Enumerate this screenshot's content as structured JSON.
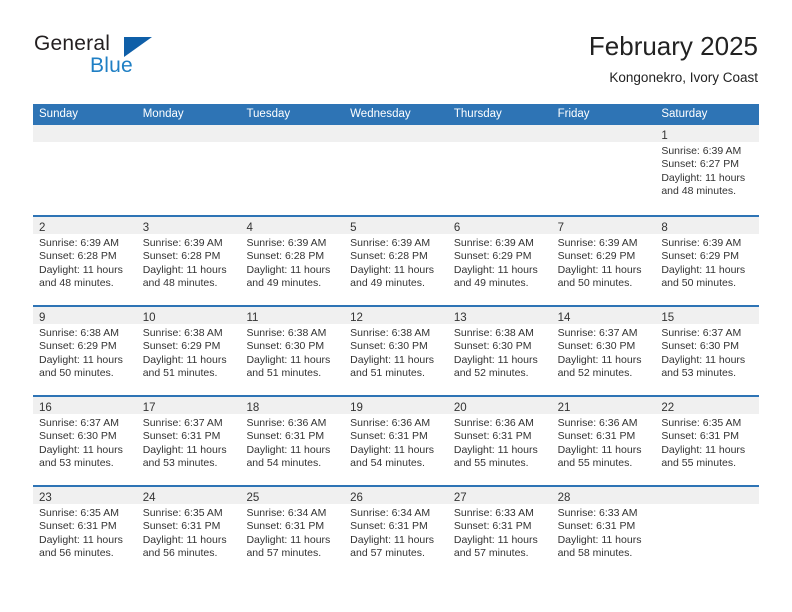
{
  "brand": {
    "name_part1": "General",
    "name_part2": "Blue",
    "accent_color": "#1f7fc4",
    "logo_triangle_color": "#0f5fa8"
  },
  "header": {
    "title": "February 2025",
    "subtitle": "Kongonekro, Ivory Coast"
  },
  "calendar": {
    "header_bg": "#2e74b5",
    "row_divider_color": "#2e74b5",
    "day_strip_bg": "#f0f0f0",
    "weekdays": [
      "Sunday",
      "Monday",
      "Tuesday",
      "Wednesday",
      "Thursday",
      "Friday",
      "Saturday"
    ],
    "weeks": [
      [
        {
          "day": "",
          "lines": []
        },
        {
          "day": "",
          "lines": []
        },
        {
          "day": "",
          "lines": []
        },
        {
          "day": "",
          "lines": []
        },
        {
          "day": "",
          "lines": []
        },
        {
          "day": "",
          "lines": []
        },
        {
          "day": "1",
          "lines": [
            "Sunrise: 6:39 AM",
            "Sunset: 6:27 PM",
            "Daylight: 11 hours",
            "and 48 minutes."
          ]
        }
      ],
      [
        {
          "day": "2",
          "lines": [
            "Sunrise: 6:39 AM",
            "Sunset: 6:28 PM",
            "Daylight: 11 hours",
            "and 48 minutes."
          ]
        },
        {
          "day": "3",
          "lines": [
            "Sunrise: 6:39 AM",
            "Sunset: 6:28 PM",
            "Daylight: 11 hours",
            "and 48 minutes."
          ]
        },
        {
          "day": "4",
          "lines": [
            "Sunrise: 6:39 AM",
            "Sunset: 6:28 PM",
            "Daylight: 11 hours",
            "and 49 minutes."
          ]
        },
        {
          "day": "5",
          "lines": [
            "Sunrise: 6:39 AM",
            "Sunset: 6:28 PM",
            "Daylight: 11 hours",
            "and 49 minutes."
          ]
        },
        {
          "day": "6",
          "lines": [
            "Sunrise: 6:39 AM",
            "Sunset: 6:29 PM",
            "Daylight: 11 hours",
            "and 49 minutes."
          ]
        },
        {
          "day": "7",
          "lines": [
            "Sunrise: 6:39 AM",
            "Sunset: 6:29 PM",
            "Daylight: 11 hours",
            "and 50 minutes."
          ]
        },
        {
          "day": "8",
          "lines": [
            "Sunrise: 6:39 AM",
            "Sunset: 6:29 PM",
            "Daylight: 11 hours",
            "and 50 minutes."
          ]
        }
      ],
      [
        {
          "day": "9",
          "lines": [
            "Sunrise: 6:38 AM",
            "Sunset: 6:29 PM",
            "Daylight: 11 hours",
            "and 50 minutes."
          ]
        },
        {
          "day": "10",
          "lines": [
            "Sunrise: 6:38 AM",
            "Sunset: 6:29 PM",
            "Daylight: 11 hours",
            "and 51 minutes."
          ]
        },
        {
          "day": "11",
          "lines": [
            "Sunrise: 6:38 AM",
            "Sunset: 6:30 PM",
            "Daylight: 11 hours",
            "and 51 minutes."
          ]
        },
        {
          "day": "12",
          "lines": [
            "Sunrise: 6:38 AM",
            "Sunset: 6:30 PM",
            "Daylight: 11 hours",
            "and 51 minutes."
          ]
        },
        {
          "day": "13",
          "lines": [
            "Sunrise: 6:38 AM",
            "Sunset: 6:30 PM",
            "Daylight: 11 hours",
            "and 52 minutes."
          ]
        },
        {
          "day": "14",
          "lines": [
            "Sunrise: 6:37 AM",
            "Sunset: 6:30 PM",
            "Daylight: 11 hours",
            "and 52 minutes."
          ]
        },
        {
          "day": "15",
          "lines": [
            "Sunrise: 6:37 AM",
            "Sunset: 6:30 PM",
            "Daylight: 11 hours",
            "and 53 minutes."
          ]
        }
      ],
      [
        {
          "day": "16",
          "lines": [
            "Sunrise: 6:37 AM",
            "Sunset: 6:30 PM",
            "Daylight: 11 hours",
            "and 53 minutes."
          ]
        },
        {
          "day": "17",
          "lines": [
            "Sunrise: 6:37 AM",
            "Sunset: 6:31 PM",
            "Daylight: 11 hours",
            "and 53 minutes."
          ]
        },
        {
          "day": "18",
          "lines": [
            "Sunrise: 6:36 AM",
            "Sunset: 6:31 PM",
            "Daylight: 11 hours",
            "and 54 minutes."
          ]
        },
        {
          "day": "19",
          "lines": [
            "Sunrise: 6:36 AM",
            "Sunset: 6:31 PM",
            "Daylight: 11 hours",
            "and 54 minutes."
          ]
        },
        {
          "day": "20",
          "lines": [
            "Sunrise: 6:36 AM",
            "Sunset: 6:31 PM",
            "Daylight: 11 hours",
            "and 55 minutes."
          ]
        },
        {
          "day": "21",
          "lines": [
            "Sunrise: 6:36 AM",
            "Sunset: 6:31 PM",
            "Daylight: 11 hours",
            "and 55 minutes."
          ]
        },
        {
          "day": "22",
          "lines": [
            "Sunrise: 6:35 AM",
            "Sunset: 6:31 PM",
            "Daylight: 11 hours",
            "and 55 minutes."
          ]
        }
      ],
      [
        {
          "day": "23",
          "lines": [
            "Sunrise: 6:35 AM",
            "Sunset: 6:31 PM",
            "Daylight: 11 hours",
            "and 56 minutes."
          ]
        },
        {
          "day": "24",
          "lines": [
            "Sunrise: 6:35 AM",
            "Sunset: 6:31 PM",
            "Daylight: 11 hours",
            "and 56 minutes."
          ]
        },
        {
          "day": "25",
          "lines": [
            "Sunrise: 6:34 AM",
            "Sunset: 6:31 PM",
            "Daylight: 11 hours",
            "and 57 minutes."
          ]
        },
        {
          "day": "26",
          "lines": [
            "Sunrise: 6:34 AM",
            "Sunset: 6:31 PM",
            "Daylight: 11 hours",
            "and 57 minutes."
          ]
        },
        {
          "day": "27",
          "lines": [
            "Sunrise: 6:33 AM",
            "Sunset: 6:31 PM",
            "Daylight: 11 hours",
            "and 57 minutes."
          ]
        },
        {
          "day": "28",
          "lines": [
            "Sunrise: 6:33 AM",
            "Sunset: 6:31 PM",
            "Daylight: 11 hours",
            "and 58 minutes."
          ]
        },
        {
          "day": "",
          "lines": []
        }
      ]
    ]
  }
}
